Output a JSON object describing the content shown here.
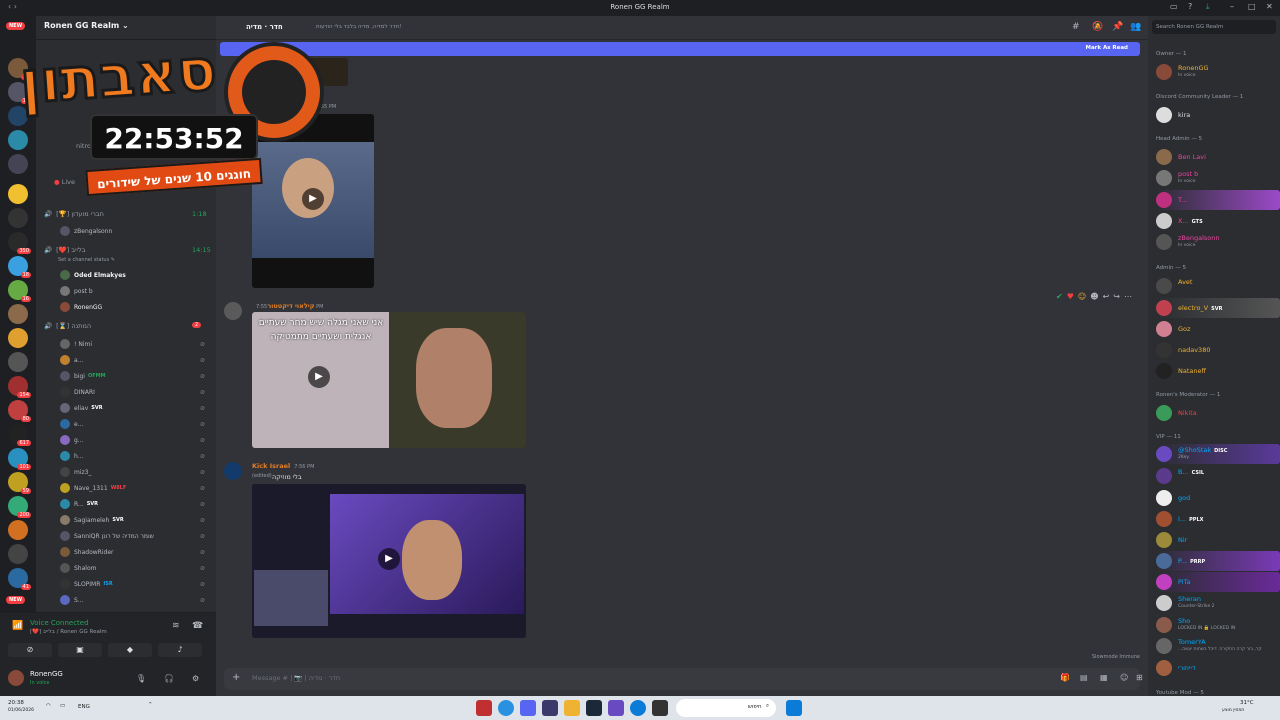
{
  "window": {
    "title": "Ronen GG Realm",
    "nav": "‹ ›"
  },
  "server": {
    "name": "Ronen GG Realm",
    "rail_new_top": "NEW",
    "rail_new_bottom": "NEW",
    "rail_badges": [
      "17",
      "11",
      "350",
      "18",
      "16",
      "154",
      "80",
      "617",
      "101",
      "59",
      "200",
      "41"
    ]
  },
  "sidebar": {
    "channels": [
      {
        "name": "[🏆] חברי מועדון",
        "time": "1:18"
      },
      {
        "name": "[❤️] בלייב",
        "time": "14:15"
      },
      {
        "name": "[⌛] המתנה",
        "badge": "2"
      }
    ],
    "live_label": "Live",
    "nitro_label": "nitro",
    "set_status": "Set a channel status ✎",
    "club_members": [
      "zBengalsonn"
    ],
    "live_members": [
      "Oded Elmakyes",
      "post b",
      "RonenGG"
    ],
    "waiting_members": [
      {
        "name": "! Nimi"
      },
      {
        "name": "a..."
      },
      {
        "name": "bigi",
        "tag": "OFMM",
        "tag_color": "#23a559"
      },
      {
        "name": "DINARI"
      },
      {
        "name": "eliav",
        "tag": "SVR",
        "tag_color": "#dbdee1"
      },
      {
        "name": "e..."
      },
      {
        "name": "g..."
      },
      {
        "name": "h..."
      },
      {
        "name": "miz3_"
      },
      {
        "name": "Nave_1311",
        "tag": "W8LF",
        "tag_color": "#f23f43"
      },
      {
        "name": "R...",
        "tag": "SVR",
        "tag_color": "#dbdee1"
      },
      {
        "name": "Sagiameleh",
        "tag": "SVR",
        "tag_color": "#dbdee1"
      },
      {
        "name": "SanniQR שומר המדיה של רונן"
      },
      {
        "name": "ShadowRider"
      },
      {
        "name": "Shalom"
      },
      {
        "name": "SLOPIMR",
        "tag": "ISR",
        "tag_color": "#00a8fc"
      },
      {
        "name": "S..."
      }
    ]
  },
  "voice": {
    "status": "Voice Connected",
    "channel": "[❤️] בלייב / Ronen GG Realm"
  },
  "user": {
    "name": "RonenGG",
    "status": "In voice"
  },
  "channel": {
    "name": "חדר · מדיה",
    "topic": "חדר למדיה, מדיה בלבד בלי הודעות!",
    "mark_as_read": "Mark As Read"
  },
  "messages": [
    {
      "time": "7:55 PM"
    },
    {
      "author": "קילאוי דיקטטור",
      "author_color": "#e67e22",
      "time": "7:55 PM",
      "video_text": "אני שאני מגלה שיש מחר שעתיים אנגלית ושעתיים מתמטיקה"
    },
    {
      "author": "Kick Israel",
      "author_color": "#e67e22",
      "time": "7:56 PM",
      "edited": "(edited)",
      "content": "בלי מוזיקה"
    }
  ],
  "composer": {
    "placeholder": "Message # | 📷 | חדר · מדיה",
    "slowmode": "Slowmode Immune"
  },
  "members": {
    "search_placeholder": "Search Ronen GG Realm",
    "groups": [
      {
        "role": "Owner — 1",
        "list": [
          {
            "name": "RonenGG",
            "color": "#f0b232",
            "status": "In voice"
          }
        ]
      },
      {
        "role": "Discord Community Leader — 1",
        "list": [
          {
            "name": "kira",
            "color": "#dbdee1"
          }
        ]
      },
      {
        "role": "Head Admin — 5",
        "list": [
          {
            "name": "Ben Lavi",
            "color": "#eb459e"
          },
          {
            "name": "post b",
            "color": "#eb459e",
            "status": "In voice"
          },
          {
            "name": "T...",
            "color": "#eb459e"
          },
          {
            "name": "X...",
            "color": "#eb459e",
            "tag": "GTS"
          },
          {
            "name": "zBengalsonn",
            "color": "#eb459e",
            "status": "In voice"
          }
        ]
      },
      {
        "role": "Admin — 5",
        "list": [
          {
            "name": "Avet",
            "color": "#f0b232"
          },
          {
            "name": "electro_V",
            "color": "#f0b232",
            "tag": "SVR"
          },
          {
            "name": "Goz",
            "color": "#f0b232"
          },
          {
            "name": "nadav380",
            "color": "#f0b232"
          },
          {
            "name": "Nataneff",
            "color": "#f0b232"
          }
        ]
      },
      {
        "role": "Ronen's Moderator — 1",
        "list": [
          {
            "name": "Nikita",
            "color": "#f23f43"
          }
        ]
      },
      {
        "role": "VIP — 11",
        "list": [
          {
            "name": "@ShoStak",
            "color": "#00a8fc",
            "tag": "DISC",
            "status": "2Key"
          },
          {
            "name": "B...",
            "color": "#00a8fc",
            "tag": "CSIL"
          },
          {
            "name": "god",
            "color": "#00a8fc"
          },
          {
            "name": "I...",
            "color": "#00a8fc",
            "tag": "PPLX"
          },
          {
            "name": "Nir",
            "color": "#00a8fc"
          },
          {
            "name": "P...",
            "color": "#00a8fc",
            "tag": "PRRP"
          },
          {
            "name": "PiTa",
            "color": "#00a8fc"
          },
          {
            "name": "Sheran",
            "color": "#00a8fc",
            "status": "Counter-Strike 2"
          },
          {
            "name": "Sho",
            "color": "#00a8fc",
            "status": "LOCKED IN 🔒 LOCKED IN"
          },
          {
            "name": "TomerYA",
            "color": "#00a8fc",
            "status": "...קר, בור קרה החקירה. דיבל בשחות יעשה"
          },
          {
            "name": "דייוזורי",
            "color": "#00a8fc"
          }
        ]
      },
      {
        "role": "Youtube Mod — 5",
        "list": []
      }
    ]
  },
  "overlay": {
    "title": "סאבתון",
    "clock": "22:53:52",
    "subtitle": "חוגגים 10 שנים של שידורים"
  },
  "taskbar": {
    "time": "20:38",
    "date": "01/06/2026",
    "lang": "ENG",
    "search": "חיפוש",
    "weather": "31°C",
    "weather_sub": "חמסין מוצע"
  },
  "colors": {
    "accent": "#5865f2",
    "online": "#23a559",
    "danger": "#f23f43",
    "overlay_orange": "#f07a1f"
  }
}
